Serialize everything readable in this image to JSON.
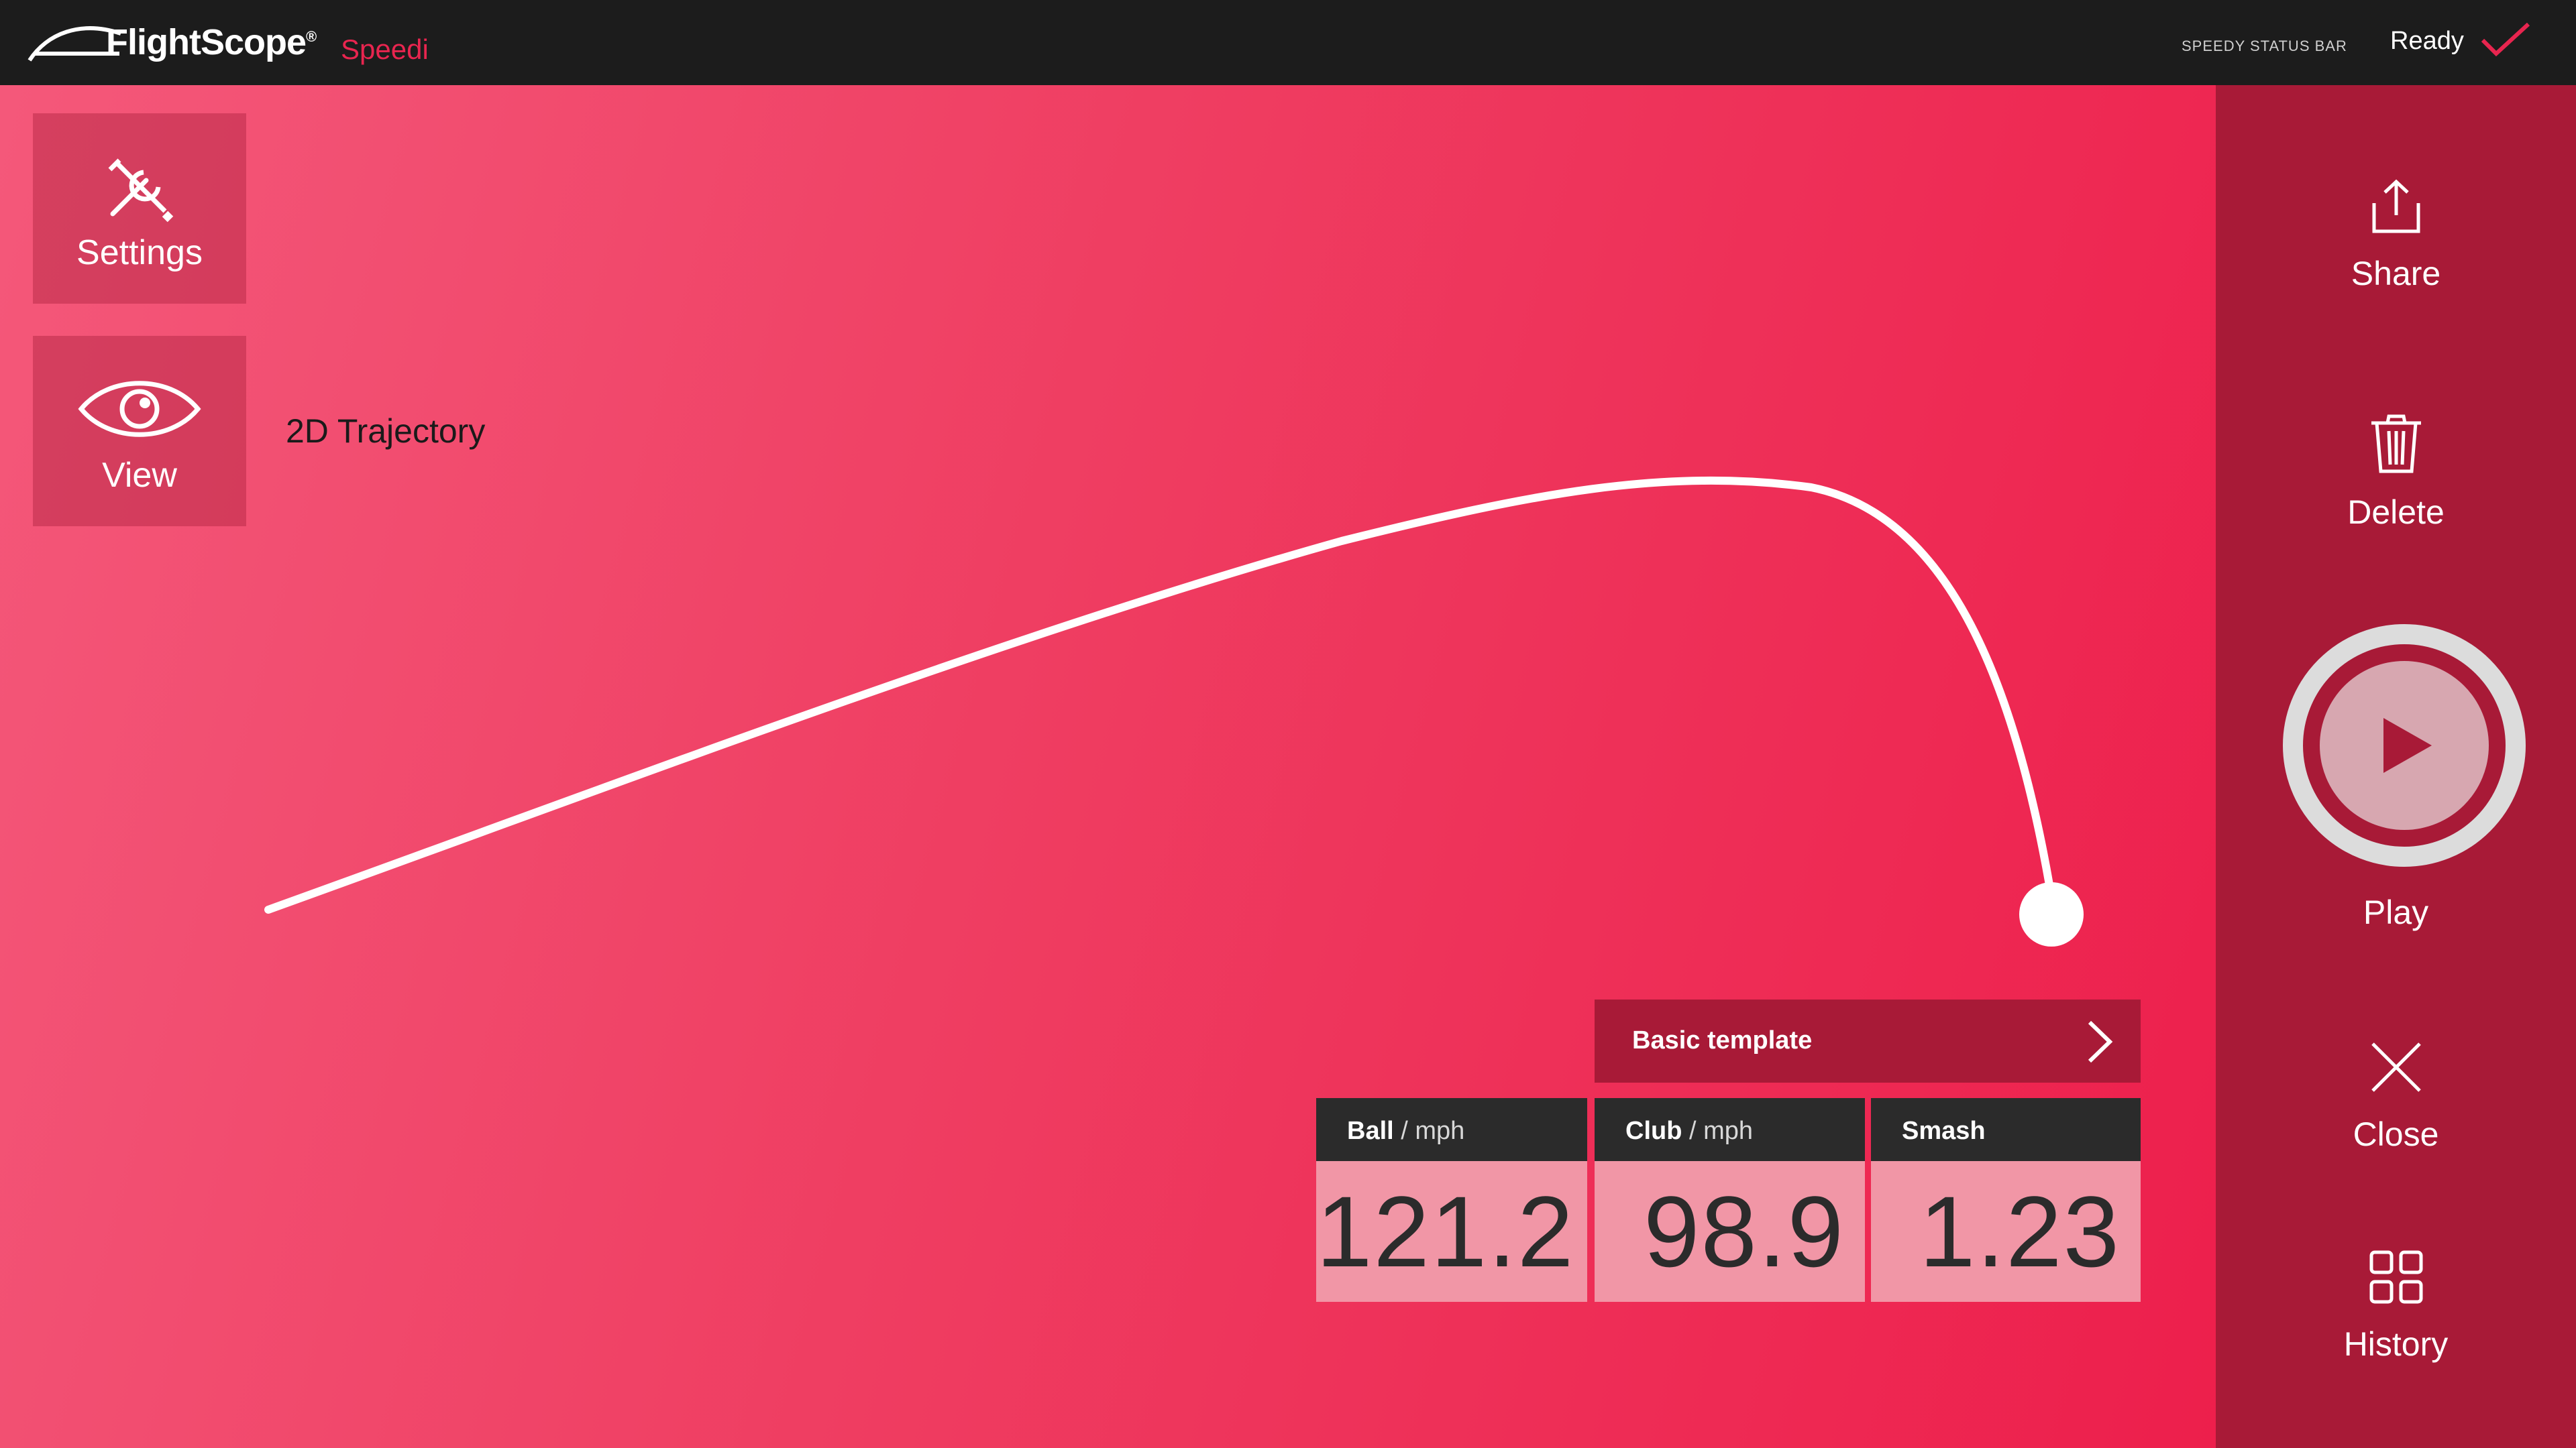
{
  "app": {
    "brand": "FlightScope",
    "brand_mark": "®",
    "product": "Speedi"
  },
  "status_bar": {
    "label": "SPEEDY STATUS BAR",
    "status": "Ready",
    "status_icon": "check-icon"
  },
  "tiles": {
    "settings": {
      "label": "Settings",
      "icon": "wrench-screwdriver-icon"
    },
    "view": {
      "label": "View",
      "icon": "eye-icon"
    }
  },
  "view_title": "2D Trajectory",
  "template": {
    "label": "Basic template",
    "icon": "chevron-right-icon"
  },
  "metrics": [
    {
      "name": "Ball",
      "unit": "/ mph",
      "value": "121.2"
    },
    {
      "name": "Club",
      "unit": "/ mph",
      "value": "98.9"
    },
    {
      "name": "Smash",
      "unit": "",
      "value": "1.23"
    }
  ],
  "sidebar": {
    "share": "Share",
    "delete": "Delete",
    "play": "Play",
    "close": "Close",
    "history": "History"
  },
  "colors": {
    "accent": "#e8254f",
    "sidebar": "#a81a37",
    "metric_value_bg": "#f196a6",
    "metric_header_bg": "#2b2b2b",
    "topbar": "#1c1c1c"
  }
}
